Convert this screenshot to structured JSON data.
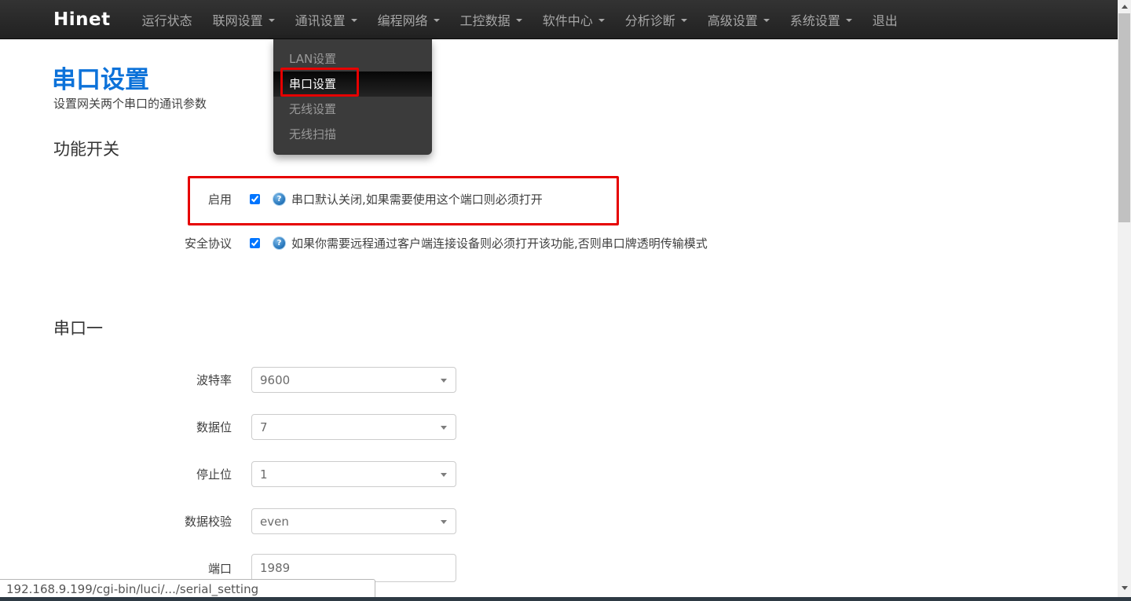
{
  "navbar": {
    "brand": "Hinet",
    "items": [
      {
        "label": "运行状态",
        "caret": false
      },
      {
        "label": "联网设置",
        "caret": true
      },
      {
        "label": "通讯设置",
        "caret": true
      },
      {
        "label": "编程网络",
        "caret": true
      },
      {
        "label": "工控数据",
        "caret": true
      },
      {
        "label": "软件中心",
        "caret": true
      },
      {
        "label": "分析诊断",
        "caret": true
      },
      {
        "label": "高级设置",
        "caret": true
      },
      {
        "label": "系统设置",
        "caret": true
      },
      {
        "label": "退出",
        "caret": false
      }
    ]
  },
  "dropdown": {
    "parent": "通讯设置",
    "items": [
      {
        "label": "LAN设置",
        "active": false
      },
      {
        "label": "串口设置",
        "active": true
      },
      {
        "label": "无线设置",
        "active": false
      },
      {
        "label": "无线扫描",
        "active": false
      }
    ]
  },
  "page": {
    "title": "串口设置",
    "subtitle": "设置网关两个串口的通讯参数"
  },
  "switch_section": {
    "heading": "功能开关",
    "rows": [
      {
        "label": "启用",
        "checked": true,
        "help": "串口默认关闭,如果需要使用这个端口则必须打开"
      },
      {
        "label": "安全协议",
        "checked": true,
        "help": "如果你需要远程通过客户端连接设备则必须打开该功能,否则串口牌透明传输模式"
      }
    ]
  },
  "serial1": {
    "heading": "串口一",
    "fields": [
      {
        "label": "波特率",
        "value": "9600",
        "type": "select"
      },
      {
        "label": "数据位",
        "value": "7",
        "type": "select"
      },
      {
        "label": "停止位",
        "value": "1",
        "type": "select"
      },
      {
        "label": "数据校验",
        "value": "even",
        "type": "select"
      },
      {
        "label": "端口",
        "value": "1989",
        "type": "input"
      }
    ]
  },
  "statusbar": {
    "url": "192.168.9.199/cgi-bin/luci/.../serial_setting"
  },
  "icons": {
    "help_glyph": "?"
  },
  "colors": {
    "accent_blue": "#0c72d9",
    "annotation_red": "#e60000",
    "navbar_bg": "#2a2a2a",
    "dropdown_bg": "#3b3b3b",
    "help_icon_blue": "#2c7bbf",
    "scrollbar_thumb": "#c1c1c1",
    "bottom_strip": "#2e3a44"
  }
}
